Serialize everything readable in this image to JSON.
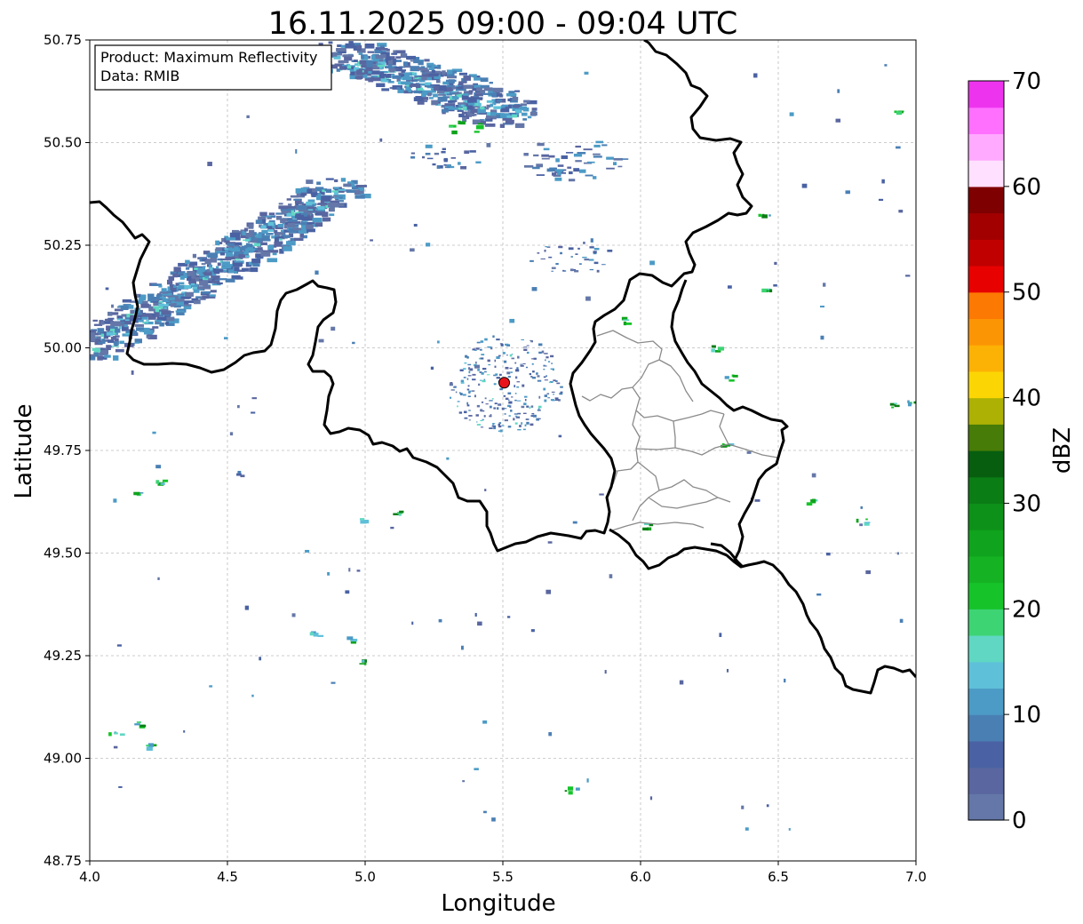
{
  "map": {
    "title": "16.11.2025 09:00 - 09:04 UTC",
    "info_box": {
      "product_line": "Product: Maximum Reflectivity",
      "data_line": "Data: RMIB"
    },
    "x_axis": {
      "label": "Longitude",
      "range": [
        4.0,
        7.0
      ],
      "ticks": [
        "4.0",
        "4.5",
        "5.0",
        "5.5",
        "6.0",
        "6.5",
        "7.0"
      ]
    },
    "y_axis": {
      "label": "Latitude",
      "range": [
        48.75,
        50.75
      ],
      "ticks": [
        "48.75",
        "49.00",
        "49.25",
        "49.50",
        "49.75",
        "50.00",
        "50.25",
        "50.50",
        "50.75"
      ]
    },
    "grid": true,
    "radar_site": {
      "lon": 5.505,
      "lat": 49.915,
      "color": "#e8141b"
    },
    "colorbar": {
      "label": "dBZ",
      "range": [
        0,
        70
      ],
      "ticks": [
        "0",
        "10",
        "20",
        "30",
        "40",
        "50",
        "60",
        "70"
      ],
      "colors": [
        "#6477a8",
        "#5966a0",
        "#4a62a3",
        "#4a7fb4",
        "#4c9bc6",
        "#5fc0d9",
        "#5fd7c3",
        "#3dd474",
        "#16c42a",
        "#15b324",
        "#10a31d",
        "#0e9119",
        "#0b7d15",
        "#075e0f",
        "#477c08",
        "#adb104",
        "#fcd604",
        "#fcb204",
        "#fc9504",
        "#fc7904",
        "#e80101",
        "#c00000",
        "#a20000",
        "#7e0000",
        "#ffe0ff",
        "#ffaaff",
        "#ff70ff",
        "#ee33ee"
      ]
    },
    "legend_colors": {
      "border_line": "#000000",
      "region_line": "#8a8a8a"
    }
  }
}
